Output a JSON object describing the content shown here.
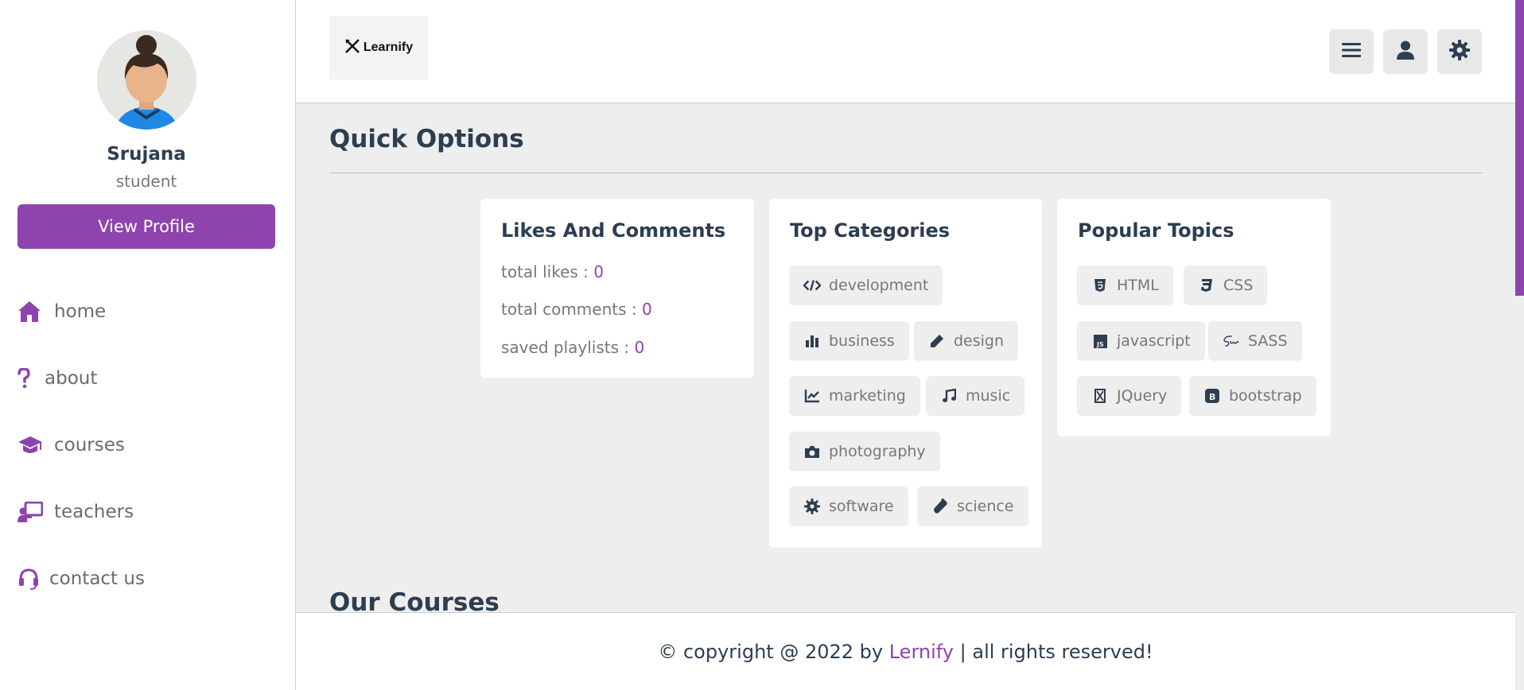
{
  "sidebar": {
    "profile": {
      "name": "Srujana",
      "role": "student",
      "button_label": "View Profile"
    },
    "nav": [
      {
        "label": "home",
        "icon": "home-icon"
      },
      {
        "label": "about",
        "icon": "question-icon"
      },
      {
        "label": "courses",
        "icon": "graduation-cap-icon"
      },
      {
        "label": "teachers",
        "icon": "chalkboard-teacher-icon"
      },
      {
        "label": "contact us",
        "icon": "headset-icon"
      }
    ]
  },
  "header": {
    "logo_text": "Learnify",
    "buttons": [
      "menu-icon",
      "user-icon",
      "gear-icon"
    ]
  },
  "main": {
    "quick_title": "Quick Options",
    "courses_title": "Our Courses",
    "likes_card": {
      "title": "Likes And Comments",
      "stats": [
        {
          "label": "total likes : ",
          "value": "0"
        },
        {
          "label": "total comments : ",
          "value": "0"
        },
        {
          "label": "saved playlists : ",
          "value": "0"
        }
      ]
    },
    "categories_card": {
      "title": "Top Categories",
      "items": [
        {
          "label": "development",
          "icon": "code-icon"
        },
        {
          "label": "business",
          "icon": "chart-bar-icon"
        },
        {
          "label": "design",
          "icon": "pen-icon"
        },
        {
          "label": "marketing",
          "icon": "chart-line-icon"
        },
        {
          "label": "music",
          "icon": "music-icon"
        },
        {
          "label": "photography",
          "icon": "camera-icon"
        },
        {
          "label": "software",
          "icon": "cog-icon"
        },
        {
          "label": "science",
          "icon": "vial-icon"
        }
      ]
    },
    "topics_card": {
      "title": "Popular Topics",
      "items": [
        {
          "label": "HTML",
          "icon": "html5-icon"
        },
        {
          "label": "CSS",
          "icon": "css3-icon"
        },
        {
          "label": "javascript",
          "icon": "js-icon"
        },
        {
          "label": "SASS",
          "icon": "sass-icon"
        },
        {
          "label": "JQuery",
          "icon": "jquery-icon"
        },
        {
          "label": "bootstrap",
          "icon": "bootstrap-icon"
        }
      ]
    }
  },
  "footer": {
    "prefix": "© copyright @ 2022 by ",
    "brand": "Lernify",
    "suffix": " | all rights reserved!"
  },
  "colors": {
    "accent": "#8e44ad",
    "text": "#2c3e50",
    "muted": "#777777",
    "background": "#eeeeee"
  }
}
